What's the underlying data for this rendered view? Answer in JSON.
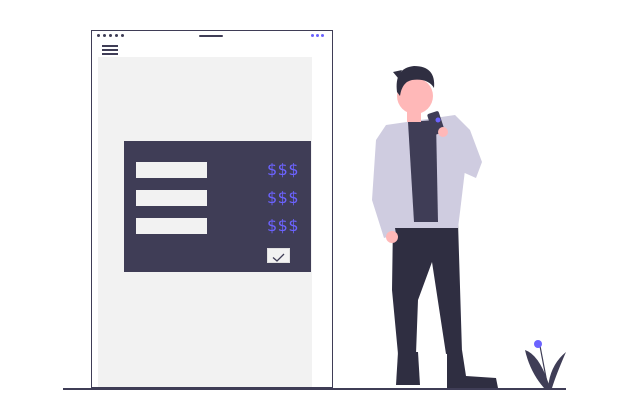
{
  "form": {
    "rows": [
      {
        "price": "$$$"
      },
      {
        "price": "$$$"
      },
      {
        "price": "$$$"
      }
    ]
  },
  "colors": {
    "dark": "#3f3d56",
    "accent": "#6c63ff",
    "light": "#f2f2f2",
    "skin": "#ffb8b8",
    "jacket": "#cfcce0"
  },
  "icons": [
    "menu-icon",
    "checkmark-icon",
    "plant-icon"
  ]
}
